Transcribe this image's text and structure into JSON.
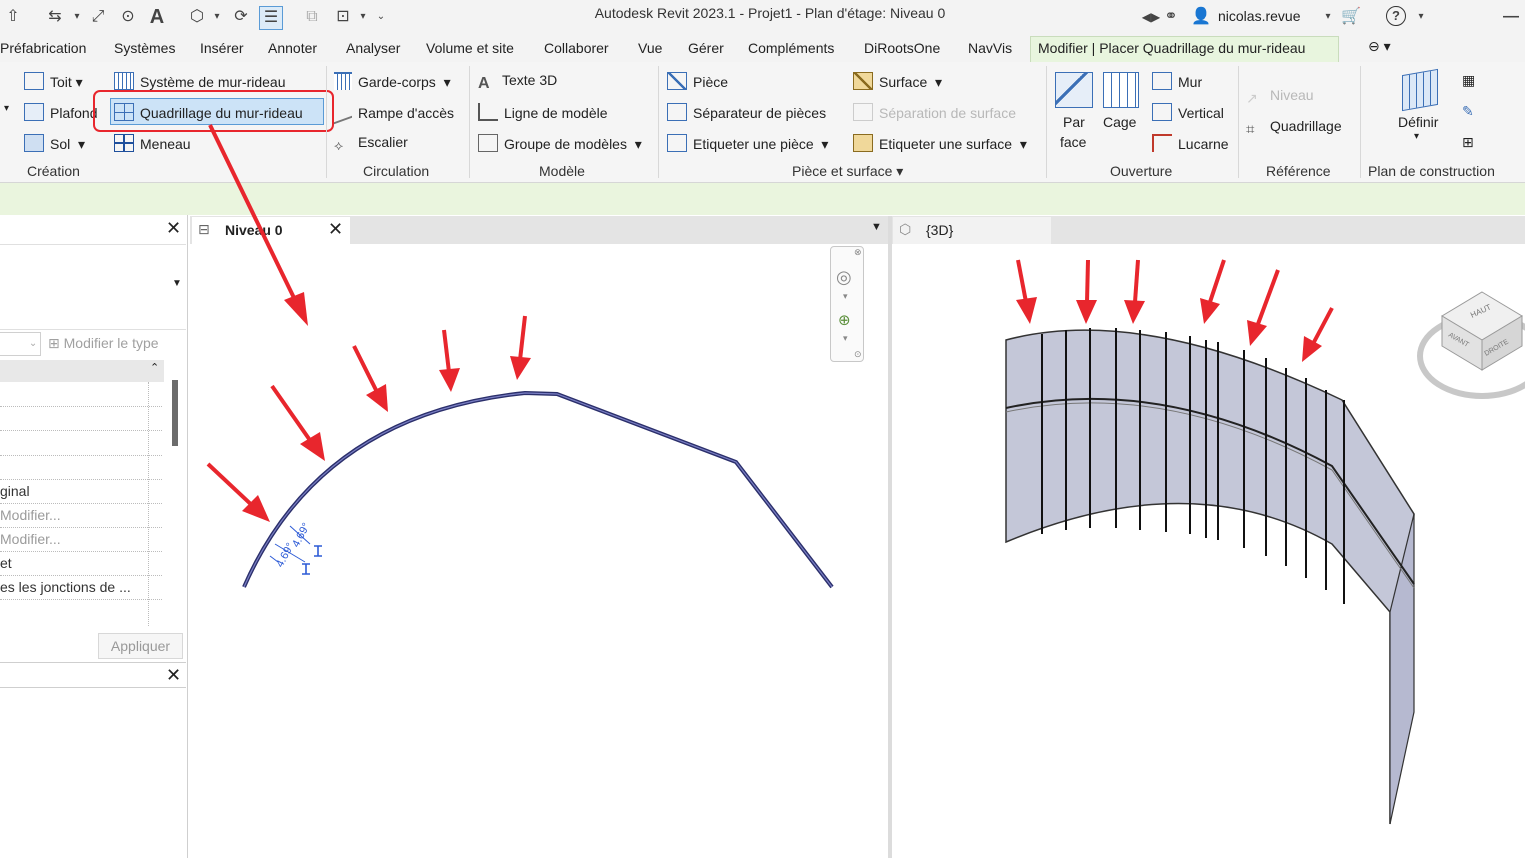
{
  "title_bar": {
    "app_title": "Autodesk Revit 2023.1 - Projet1 - Plan d'étage: Niveau 0",
    "user": "nicolas.revue"
  },
  "menu": {
    "tabs": [
      "Préfabrication",
      "Systèmes",
      "Insérer",
      "Annoter",
      "Analyser",
      "Volume et site",
      "Collaborer",
      "Vue",
      "Gérer",
      "Compléments",
      "DiRootsOne",
      "NavVis"
    ],
    "active_tab": "Modifier | Placer Quadrillage du mur-rideau"
  },
  "ribbon": {
    "creation": {
      "label": "Création",
      "toit": "Toit",
      "systeme": "Système de mur-rideau",
      "plafond": "Plafond",
      "quadrillage": "Quadrillage du mur-rideau",
      "sol": "Sol",
      "meneau": "Meneau"
    },
    "circulation": {
      "label": "Circulation",
      "garde_corps": "Garde-corps",
      "rampe": "Rampe d'accès",
      "escalier": "Escalier"
    },
    "modele": {
      "label": "Modèle",
      "texte3d": "Texte 3D",
      "ligne": "Ligne de modèle",
      "groupe": "Groupe de modèles"
    },
    "piece_surface": {
      "label": "Pièce et surface",
      "piece": "Pièce",
      "separateur": "Séparateur  de pièces",
      "etiqueter_piece": "Etiqueter  une pièce",
      "surface": "Surface",
      "separation_surface": "Séparation  de surface",
      "etiqueter_surface": "Etiqueter  une surface"
    },
    "ouverture": {
      "label": "Ouverture",
      "par": "Par",
      "face": "face",
      "cage": "Cage",
      "mur": "Mur",
      "vertical": "Vertical",
      "lucarne": "Lucarne"
    },
    "reference": {
      "label": "Référence",
      "niveau": "Niveau",
      "quadrillage": "Quadrillage"
    },
    "plan_construction": {
      "label": "Plan de construction",
      "definir": "Définir"
    }
  },
  "properties": {
    "modify_type": "Modifier le type",
    "rows": [
      "ginal",
      "Modifier...",
      "Modifier...",
      "et",
      "es les jonctions de ..."
    ],
    "apply": "Appliquer"
  },
  "views": {
    "plan_tab": "Niveau 0",
    "three_d_tab": "{3D}",
    "dimension_1": "4.69°",
    "dimension_2": "4.69°",
    "viewcube": {
      "top": "HAUT",
      "front": "AVANT",
      "right": "DROITE"
    }
  },
  "colors": {
    "annotation_red": "#e8262d",
    "wall_line": "#2b2f6b",
    "ribbon_highlight": "#cce3f7",
    "context_green": "#eaf5de"
  }
}
